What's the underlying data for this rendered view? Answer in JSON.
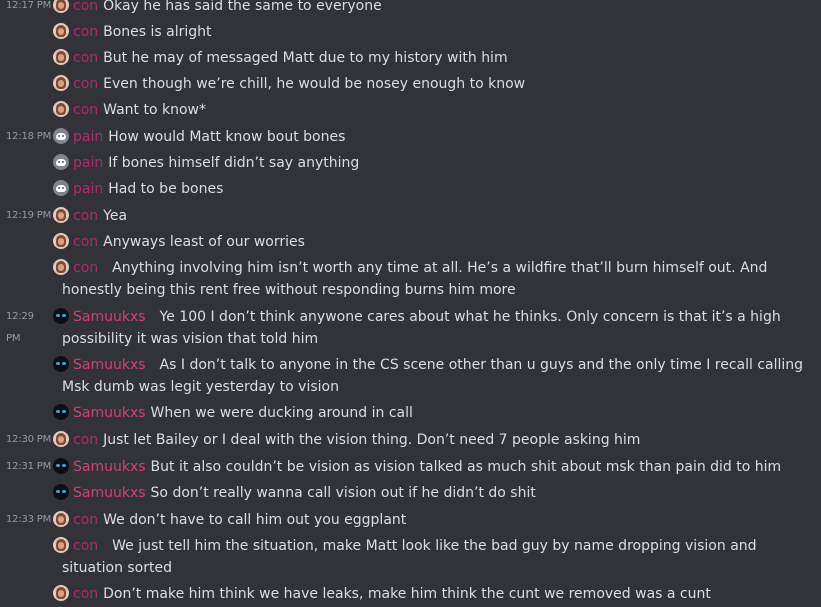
{
  "messages": [
    {
      "time": "12:17 PM",
      "user": "con",
      "text": "Okay he has said the same to everyone"
    },
    {
      "time": "",
      "user": "con",
      "text": "Bones is alright"
    },
    {
      "time": "",
      "user": "con",
      "text": "But he may of messaged Matt due to my history with him"
    },
    {
      "time": "",
      "user": "con",
      "text": "Even though we’re chill, he would be nosey enough to know"
    },
    {
      "time": "",
      "user": "con",
      "text": "Want to know*"
    },
    {
      "time": "12:18 PM",
      "user": "pain",
      "text": "How would Matt know bout bones"
    },
    {
      "time": "",
      "user": "pain",
      "text": "If bones himself didn’t say anything"
    },
    {
      "time": "",
      "user": "pain",
      "text": "Had to be bones"
    },
    {
      "time": "12:19 PM",
      "user": "con",
      "text": "Yea"
    },
    {
      "time": "",
      "user": "con",
      "text": "Anyways least of our worries"
    },
    {
      "time": "",
      "user": "con",
      "text": "Anything involving him isn’t worth any time at all. He’s a wildfire that’ll burn himself out. And honestly being this rent free without responding burns him more"
    },
    {
      "time": "12:29 PM",
      "user": "Samuukxs",
      "text": "Ye 100 I don’t think anywone cares about what he thinks. Only concern is that it’s a high possibility it was vision that told him"
    },
    {
      "time": "",
      "user": "Samuukxs",
      "text": "As I don’t talk to anyone in the CS scene other than u guys and the only time I recall calling Msk dumb was legit yesterday to vision"
    },
    {
      "time": "",
      "user": "Samuukxs",
      "text": "When we were ducking around in call"
    },
    {
      "time": "12:30 PM",
      "user": "con",
      "text": "Just let Bailey or I deal with the vision thing. Don’t need 7 people asking him"
    },
    {
      "time": "12:31 PM",
      "user": "Samuukxs",
      "text": "But it also couldn’t be vision as vision talked as much shit about msk than pain did to him"
    },
    {
      "time": "",
      "user": "Samuukxs",
      "text": "So don’t really wanna call vision out if he didn’t do shit"
    },
    {
      "time": "12:33 PM",
      "user": "con",
      "text": "We don’t have to call him out you eggplant"
    },
    {
      "time": "",
      "user": "con",
      "text": "We just tell him the situation, make Matt look like the bad guy by name dropping vision and situation sorted"
    },
    {
      "time": "",
      "user": "con",
      "text": "Don’t make him think we have leaks, make him think the cunt we removed was a cunt"
    }
  ]
}
